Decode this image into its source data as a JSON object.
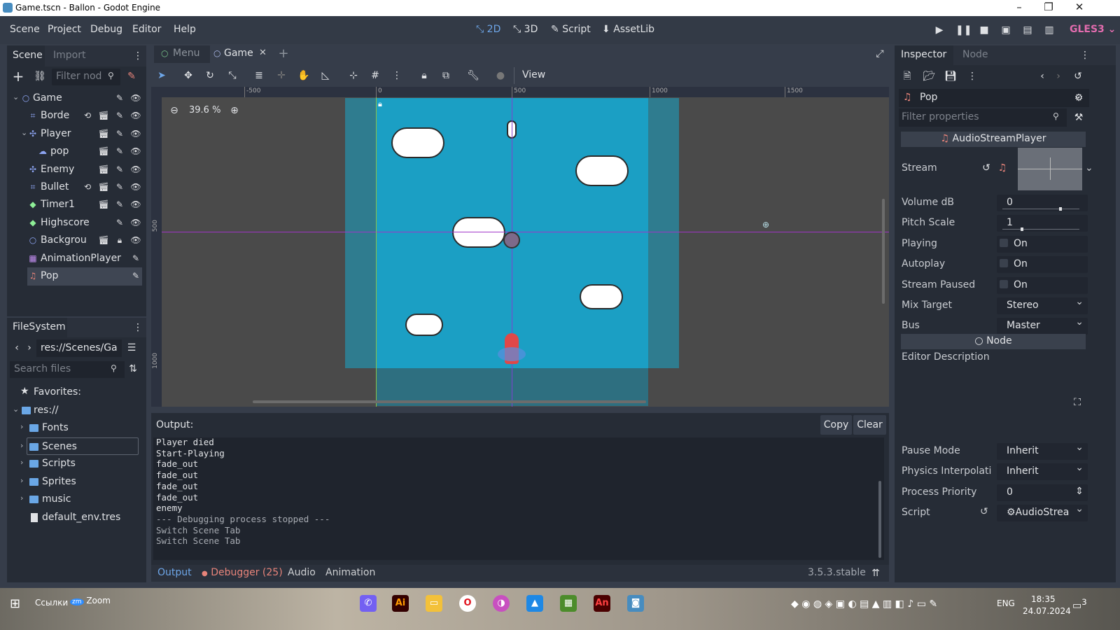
{
  "window": {
    "title": "Game.tscn - Ballon - Godot Engine",
    "controls": [
      "–",
      "❐",
      "✕"
    ]
  },
  "menu": {
    "items": [
      "Scene",
      "Project",
      "Debug",
      "Editor",
      "Help"
    ]
  },
  "modes": {
    "items": [
      "2D",
      "3D",
      "Script",
      "AssetLib"
    ],
    "active": "2D"
  },
  "renderer": "GLES3",
  "scene_dock": {
    "tabs": [
      "Scene",
      "Import"
    ],
    "filter_placeholder": "Filter nod",
    "nodes": [
      {
        "name": "Game",
        "icon": "node2d-icon",
        "indent": 0
      },
      {
        "name": "Borde",
        "icon": "staticbody-icon",
        "indent": 1
      },
      {
        "name": "Player",
        "icon": "kinematicbody-icon",
        "indent": 1
      },
      {
        "name": "pop",
        "icon": "particles-icon",
        "indent": 2
      },
      {
        "name": "Enemy",
        "icon": "kinematicbody-icon",
        "indent": 1
      },
      {
        "name": "Bullet",
        "icon": "area2d-icon",
        "indent": 1
      },
      {
        "name": "Timer1",
        "icon": "label-icon",
        "indent": 1
      },
      {
        "name": "Highscore",
        "icon": "label-icon",
        "indent": 1
      },
      {
        "name": "Backgrou",
        "icon": "node2d-icon",
        "indent": 1
      },
      {
        "name": "AnimationPlayer",
        "icon": "animation-icon",
        "indent": 1
      },
      {
        "name": "Pop",
        "icon": "audio-icon",
        "indent": 1
      }
    ]
  },
  "filesystem": {
    "title": "FileSystem",
    "path": "res://Scenes/Ga",
    "search_placeholder": "Search files",
    "items": [
      "Favorites:",
      "res://",
      "Fonts",
      "Scenes",
      "Scripts",
      "Sprites",
      "music",
      "default_env.tres"
    ]
  },
  "editor_tabs": {
    "items": [
      "Menu",
      "Game"
    ],
    "active": "Game"
  },
  "viewport": {
    "zoom": "39.6 %",
    "view_menu": "View",
    "ruler_marks": [
      "-500",
      "0",
      "500",
      "1000",
      "1500"
    ],
    "side_ruler_marks": [
      "500",
      "1000"
    ]
  },
  "output": {
    "title": "Output:",
    "copy_label": "Copy",
    "clear_label": "Clear",
    "lines": [
      {
        "text": "Player died",
        "dim": false
      },
      {
        "text": "Start-Playing",
        "dim": false
      },
      {
        "text": "fade_out",
        "dim": false
      },
      {
        "text": "fade_out",
        "dim": false
      },
      {
        "text": "fade_out",
        "dim": false
      },
      {
        "text": "fade_out",
        "dim": false
      },
      {
        "text": "enemy",
        "dim": false
      },
      {
        "text": "--- Debugging process stopped ---",
        "dim": true
      },
      {
        "text": "Switch Scene Tab",
        "dim": true
      },
      {
        "text": "Switch Scene Tab",
        "dim": true
      }
    ],
    "bottom_tabs": [
      "Output",
      "Debugger (25)",
      "Audio",
      "Animation"
    ],
    "version": "3.5.3.stable"
  },
  "inspector": {
    "tabs": [
      "Inspector",
      "Node"
    ],
    "object": "Pop",
    "filter_placeholder": "Filter properties",
    "class_header": "AudioStreamPlayer",
    "stream_label": "Stream",
    "props": [
      {
        "key": "Volume dB",
        "value": "0",
        "type": "slider",
        "level": 0.75
      },
      {
        "key": "Pitch Scale",
        "value": "1",
        "type": "slider",
        "level": 0.25
      },
      {
        "key": "Playing",
        "value": "On",
        "type": "check"
      },
      {
        "key": "Autoplay",
        "value": "On",
        "type": "check"
      },
      {
        "key": "Stream Paused",
        "value": "On",
        "type": "check"
      },
      {
        "key": "Mix Target",
        "value": "Stereo",
        "type": "dropdown"
      },
      {
        "key": "Bus",
        "value": "Master",
        "type": "dropdown"
      }
    ],
    "node_header": "Node",
    "editor_description": "Editor Description",
    "props2": [
      {
        "key": "Pause Mode",
        "value": "Inherit",
        "type": "dropdown"
      },
      {
        "key": "Physics Interpolati",
        "value": "Inherit",
        "type": "dropdown"
      },
      {
        "key": "Process Priority",
        "value": "0",
        "type": "spin"
      },
      {
        "key": "Script",
        "value": "AudioStrea",
        "type": "dropdown"
      }
    ]
  },
  "taskbar": {
    "search_text": "Ссылки",
    "zoom_label": "Zoom",
    "lang": "ENG",
    "time": "18:35",
    "date": "24.07.2024",
    "notifications": "3"
  },
  "colors": {
    "accent": "#6ea6e8",
    "sky": "#1b9fc4",
    "editor_bg": "#4a4a4a",
    "renderer": "#e26cae"
  }
}
